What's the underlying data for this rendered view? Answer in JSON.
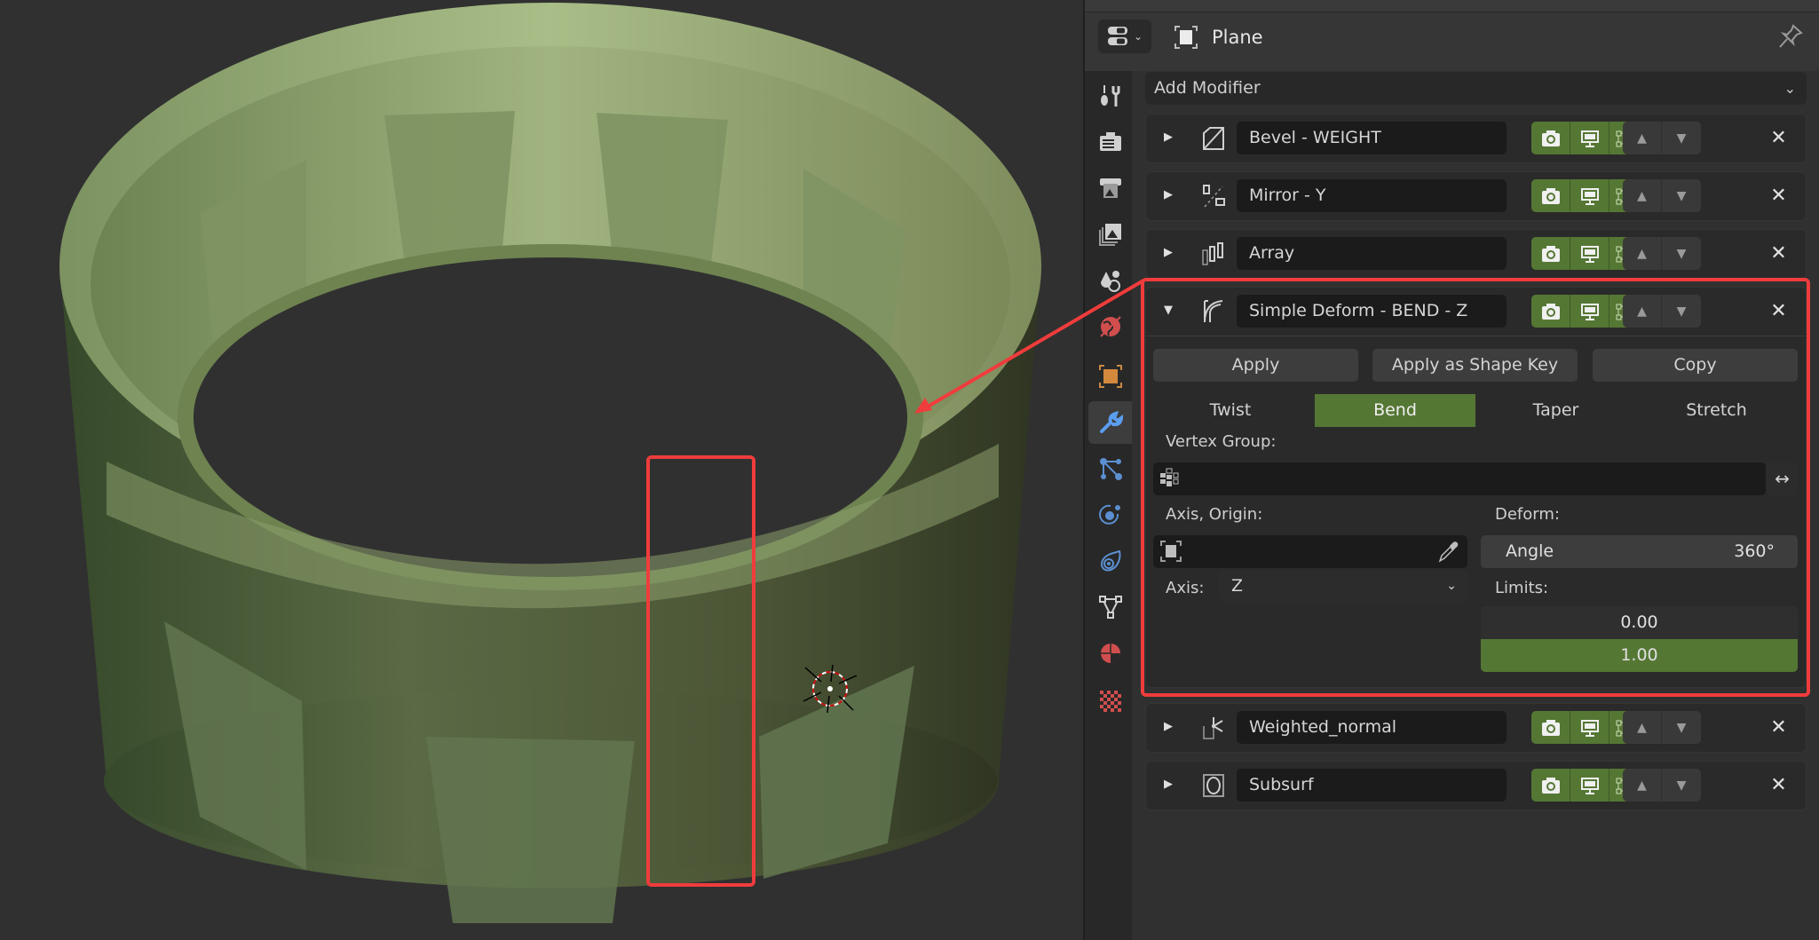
{
  "viewport": {
    "object_color": "#8a9e6a",
    "background_color": "#303030"
  },
  "header": {
    "editor_type_icon": "properties-editor-icon",
    "object_icon": "object-data-icon",
    "object_name": "Plane",
    "pin_icon": "pin-icon"
  },
  "sidebar": {
    "tabs": [
      {
        "name": "tool",
        "icon": "tool-icon",
        "active": false
      },
      {
        "name": "render",
        "icon": "render-icon",
        "active": false
      },
      {
        "name": "output",
        "icon": "output-icon",
        "active": false
      },
      {
        "name": "view-layer",
        "icon": "view-layer-icon",
        "active": false
      },
      {
        "name": "scene",
        "icon": "scene-icon",
        "active": false
      },
      {
        "name": "world",
        "icon": "world-icon",
        "active": false
      },
      {
        "name": "object",
        "icon": "object-icon",
        "active": false
      },
      {
        "name": "modifiers",
        "icon": "wrench-icon",
        "active": true
      },
      {
        "name": "particles",
        "icon": "particles-icon",
        "active": false
      },
      {
        "name": "physics",
        "icon": "physics-icon",
        "active": false
      },
      {
        "name": "constraints",
        "icon": "constraints-icon",
        "active": false
      },
      {
        "name": "data",
        "icon": "mesh-data-icon",
        "active": false
      },
      {
        "name": "material",
        "icon": "material-icon",
        "active": false
      },
      {
        "name": "texture",
        "icon": "texture-icon",
        "active": false
      }
    ]
  },
  "add_modifier": {
    "label": "Add Modifier"
  },
  "modifiers": [
    {
      "name": "Bevel - WEIGHT",
      "type_icon": "bevel-icon",
      "expanded": false
    },
    {
      "name": "Mirror - Y",
      "type_icon": "mirror-icon",
      "expanded": false
    },
    {
      "name": "Array",
      "type_icon": "array-icon",
      "expanded": false
    },
    {
      "name": "Simple Deform - BEND - Z",
      "type_icon": "simple-deform-icon",
      "expanded": true
    },
    {
      "name": "Weighted_normal",
      "type_icon": "weighted-normal-icon",
      "expanded": false
    },
    {
      "name": "Subsurf",
      "type_icon": "subsurf-icon",
      "expanded": false
    }
  ],
  "simple_deform": {
    "apply_label": "Apply",
    "apply_shape_key_label": "Apply as Shape Key",
    "copy_label": "Copy",
    "modes": [
      "Twist",
      "Bend",
      "Taper",
      "Stretch"
    ],
    "active_mode": "Bend",
    "vertex_group_label": "Vertex Group:",
    "vertex_group_value": "",
    "axis_origin_label": "Axis, Origin:",
    "axis_origin_value": "",
    "axis_label": "Axis:",
    "axis_value": "Z",
    "deform_label": "Deform:",
    "angle_label": "Angle",
    "angle_value": "360°",
    "limits_label": "Limits:",
    "limit_min": "0.00",
    "limit_max": "1.00"
  },
  "colors": {
    "accent_green": "#557734",
    "annotation_red": "#f03c3c",
    "active_tab_blue": "#5b9ef0"
  }
}
